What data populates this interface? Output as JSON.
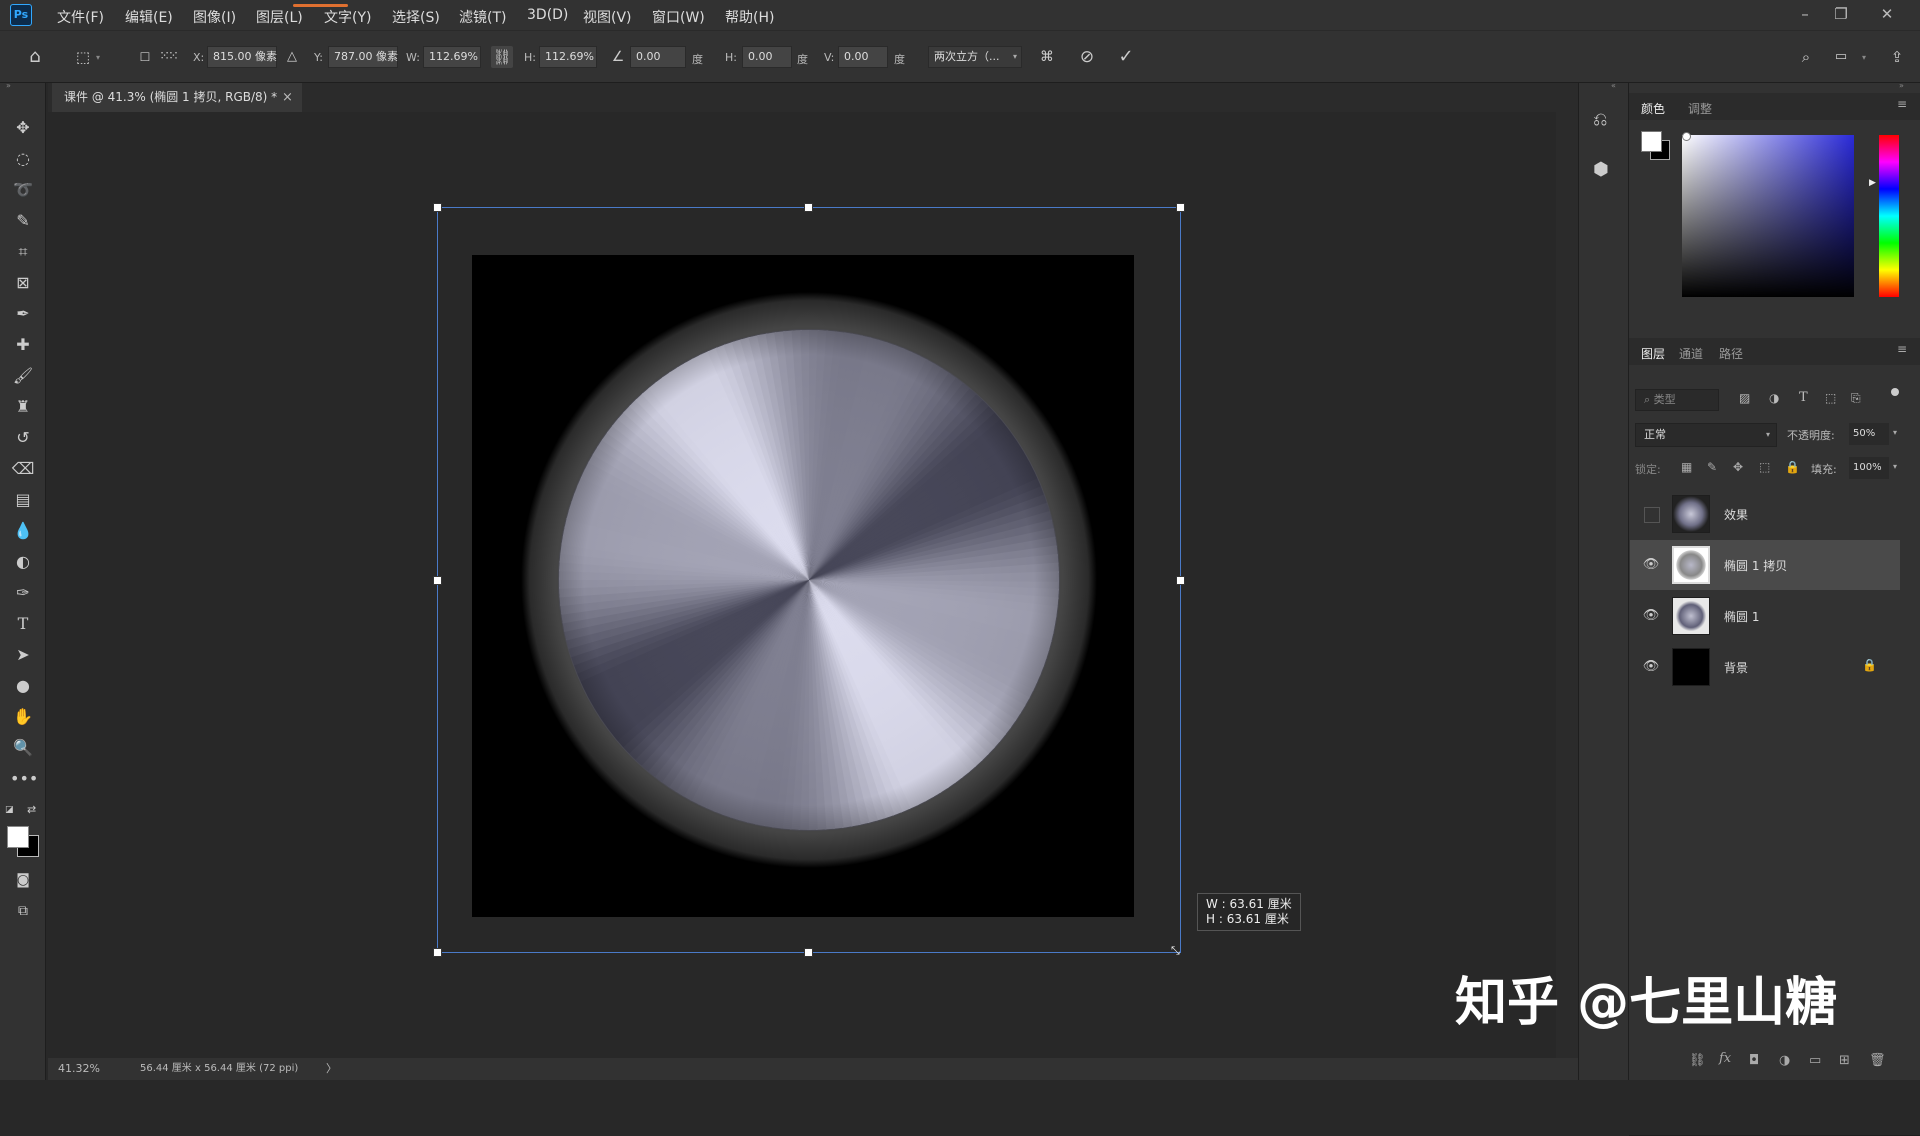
{
  "app": {
    "logo": "Ps"
  },
  "menu": [
    "文件(F)",
    "编辑(E)",
    "图像(I)",
    "图层(L)",
    "文字(Y)",
    "选择(S)",
    "滤镜(T)",
    "3D(D)",
    "视图(V)",
    "窗口(W)",
    "帮助(H)"
  ],
  "options": {
    "x_label": "X:",
    "x_value": "815.00 像素",
    "y_label": "Y:",
    "y_value": "787.00 像素",
    "w_label": "W:",
    "w_value": "112.69%",
    "h_label": "H:",
    "h_value": "112.69%",
    "angle_value": "0.00",
    "angle_unit": "度",
    "skew_h_label": "H:",
    "skew_h_value": "0.00",
    "skew_h_unit": "度",
    "skew_v_label": "V:",
    "skew_v_value": "0.00",
    "skew_v_unit": "度",
    "interpolation": "两次立方（...",
    "cancel_icon": "cancel-icon",
    "commit_icon": "checkmark-icon"
  },
  "document_tab": {
    "title": "课件 @ 41.3% (椭圆 1 拷贝, RGB/8) *",
    "close": "×"
  },
  "transform_tooltip": {
    "w": "W : 63.61 厘米",
    "h": "H : 63.61 厘米"
  },
  "status_bar": {
    "zoom": "41.32%",
    "doc_info": "56.44 厘米 x 56.44 厘米 (72 ppi)",
    "arrow": "〉"
  },
  "color_panel": {
    "tabs": [
      "颜色",
      "调整"
    ],
    "active_tab": "颜色",
    "hue_color": "#2a2ad8"
  },
  "layers_panel": {
    "tabs": [
      "图层",
      "通道",
      "路径"
    ],
    "active_tab": "图层",
    "filter_placeholder": "类型",
    "blend_mode": "正常",
    "opacity_label": "不透明度:",
    "opacity_value": "50%",
    "lock_label": "锁定:",
    "fill_label": "填充:",
    "fill_value": "100%",
    "layers": [
      {
        "name": "效果",
        "visible": false
      },
      {
        "name": "椭圆 1 拷贝",
        "visible": true,
        "selected": true
      },
      {
        "name": "椭圆 1",
        "visible": true
      },
      {
        "name": "背景",
        "visible": true,
        "locked": true
      }
    ]
  },
  "watermark": "知乎 @七里山糖"
}
